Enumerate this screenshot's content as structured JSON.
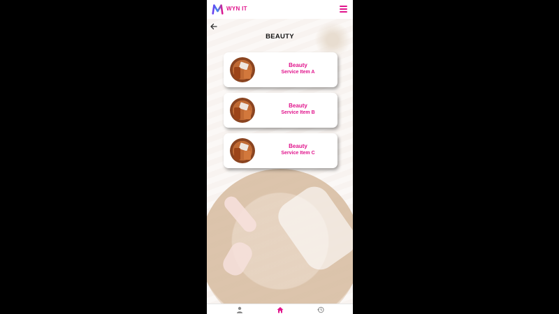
{
  "app": {
    "brand": "WYN IT",
    "accent_color": "#e1148c"
  },
  "header": {
    "logo_icon": "wyn-logo-icon",
    "menu_icon": "hamburger-menu-icon"
  },
  "page": {
    "back_icon": "arrow-left-icon",
    "title": "BEAUTY"
  },
  "services": [
    {
      "line1": "Beauty",
      "line2": "Service Item A",
      "image": "beauty-products-thumbnail"
    },
    {
      "line1": "Beauty",
      "line2": "Service Item B",
      "image": "beauty-products-thumbnail"
    },
    {
      "line1": "Beauty",
      "line2": "Service Item C",
      "image": "beauty-products-thumbnail"
    }
  ],
  "bottom_nav": [
    {
      "icon": "person-icon",
      "active": false
    },
    {
      "icon": "home-icon",
      "active": true
    },
    {
      "icon": "history-icon",
      "active": false
    }
  ]
}
